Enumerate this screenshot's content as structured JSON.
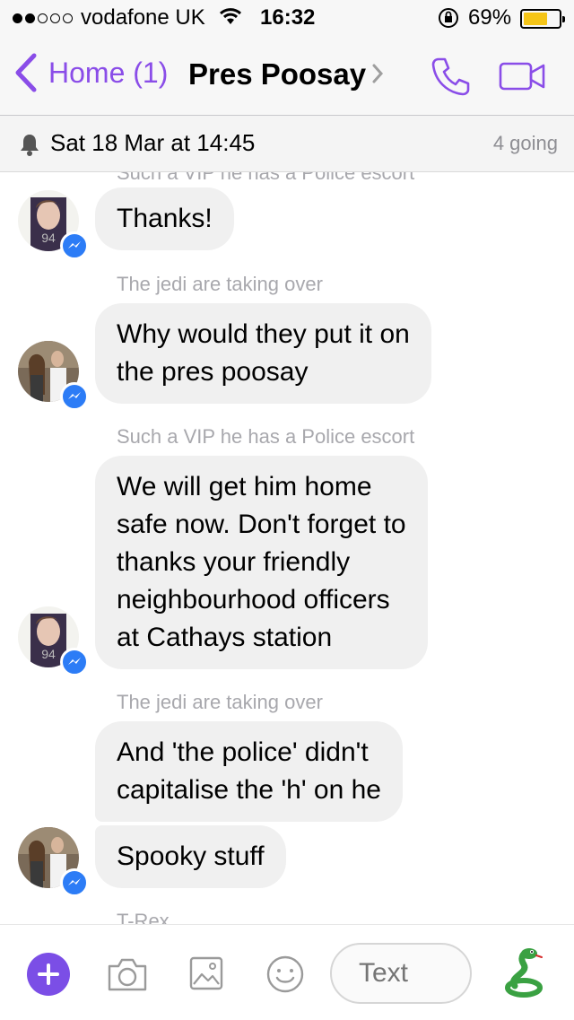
{
  "status_bar": {
    "carrier": "vodafone UK",
    "time": "16:32",
    "battery_percent": "69%",
    "battery_level": 0.69,
    "signal_bars_filled": 2,
    "signal_bars_total": 5
  },
  "nav": {
    "back_label": "Home (1)",
    "title": "Pres Poosay",
    "accent_color": "#8a4de8"
  },
  "event": {
    "date": "Sat 18 Mar at 14:45",
    "going": "4 going"
  },
  "chat": {
    "cut_sender_top": "Such a VIP he has a Police escort",
    "messages": [
      {
        "sender": "",
        "lines": [
          "Thanks!"
        ]
      },
      {
        "sender": "The jedi are taking over",
        "lines": [
          "Why would they put it on",
          "the pres poosay"
        ]
      },
      {
        "sender": "Such a VIP he has a Police escort",
        "lines": [
          "We will get him home",
          "safe now.  Don't forget to",
          "thanks your friendly",
          "neighbourhood officers",
          "at Cathays station"
        ]
      },
      {
        "sender": "The jedi are taking over",
        "lines": [
          "And 'the police' didn't",
          "capitalise the 'h' on he"
        ]
      },
      {
        "sender": "",
        "lines": [
          "Spooky stuff"
        ]
      }
    ],
    "cut_sender_bottom": "T-Rex"
  },
  "composer": {
    "placeholder": "Text",
    "icons": [
      "plus-icon",
      "camera-icon",
      "image-icon",
      "emoji-icon",
      "snake-sticker-icon"
    ]
  }
}
